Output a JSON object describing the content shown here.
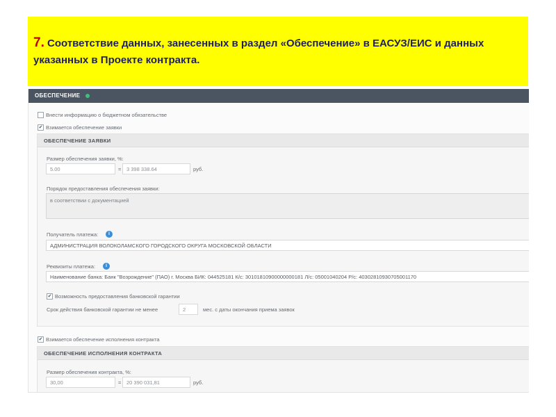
{
  "banner": {
    "number": "7.",
    "title": "Соответствие данных, занесенных в раздел «Обеспечение» в ЕАСУЗ/ЕИС и данных указанных в Проекте контракта.",
    "background": "#ffff00"
  },
  "form": {
    "header": "ОБЕСПЕЧЕНИЕ",
    "budget_checkbox_label": "Внести информацию о бюджетном обязательстве",
    "application_checkbox_label": "Взимается обеспечение заявки",
    "application_panel": {
      "title": "ОБЕСПЕЧЕНИЕ ЗАЯВКИ",
      "size_label": "Размер обеспечения заявки, %:",
      "percent": "5.00",
      "equals": "=",
      "amount": "3 398 338.64",
      "currency": "руб.",
      "procedure_label": "Порядок предоставления обеспечения заявки:",
      "procedure_text": "в соответствии с документацией",
      "recipient_label": "Получатель платежа:",
      "recipient_value": "АДМИНИСТРАЦИЯ ВОЛОКОЛАМСКОГО ГОРОДСКОГО ОКРУГА МОСКОВСКОЙ ОБЛАСТИ",
      "details_label": "Реквизиты платежа:",
      "details_value": "Наименование банка: Банк \"Возрождение\" (ПАО) г. Москва БИК: 044525181 К/с: 30101810900000000181 Л/с: 05001040204 Р/с: 40302810930705001170",
      "guarantee_checkbox_label": "Возможность предоставления банковской гарантии",
      "guarantee_term_label": "Срок действия банковской гарантии не менее",
      "guarantee_term_value": "2",
      "guarantee_term_suffix": "мес. с даты окончания приема заявок"
    },
    "contract_checkbox_label": "Взимается обеспечение исполнения контракта",
    "contract_panel": {
      "title": "ОБЕСПЕЧЕНИЕ ИСПОЛНЕНИЯ КОНТРАКТА",
      "size_label": "Размер обеспечения контракта, %:",
      "percent": "30,00",
      "equals": "=",
      "amount": "20 390 031,81",
      "currency": "руб."
    },
    "info_icon": "info-icon",
    "checkmark": "✔"
  }
}
